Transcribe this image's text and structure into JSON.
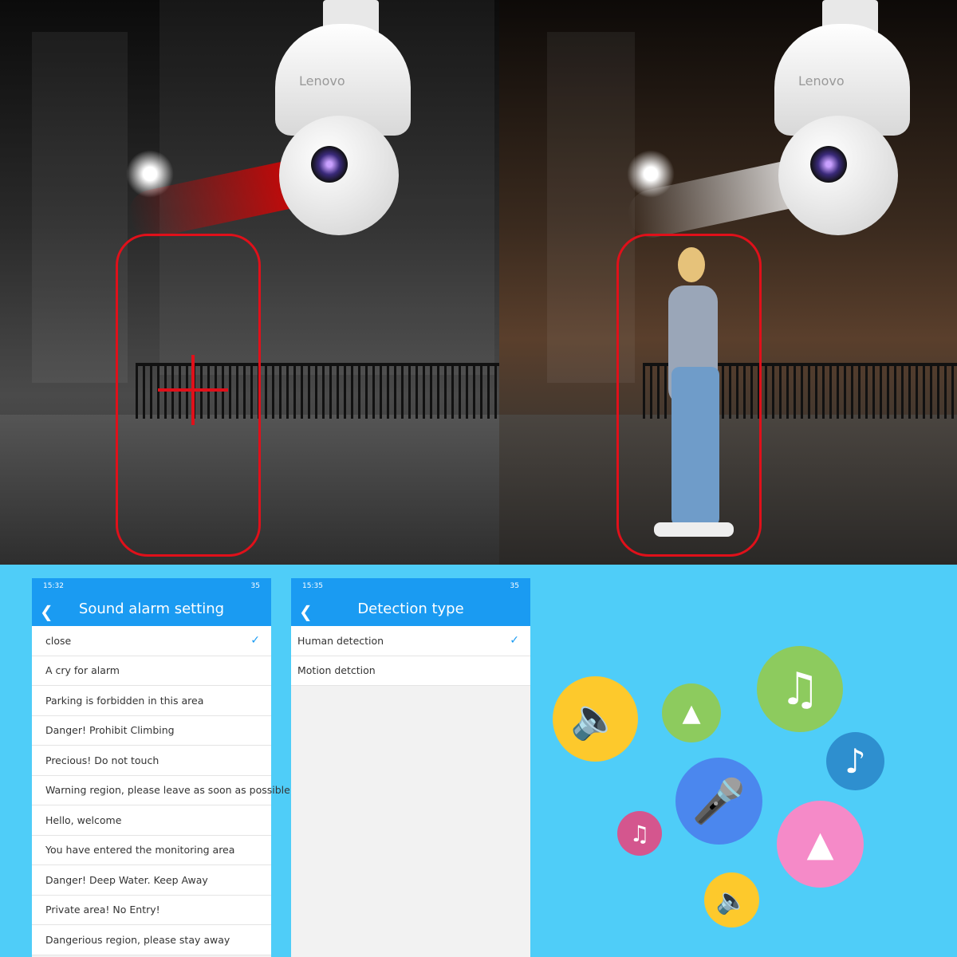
{
  "photos": {
    "camera_brand": "Lenovo"
  },
  "sound_alarm": {
    "status_time": "15:32",
    "battery": "35",
    "title": "Sound alarm setting",
    "items": [
      {
        "label": "close",
        "selected": true
      },
      {
        "label": "A cry for alarm"
      },
      {
        "label": "Parking is forbidden in this area"
      },
      {
        "label": "Danger! Prohibit Climbing"
      },
      {
        "label": "Precious! Do not touch"
      },
      {
        "label": "Warning region, please leave as soon as possible"
      },
      {
        "label": "Hello, welcome"
      },
      {
        "label": "You have entered the monitoring area"
      },
      {
        "label": "Danger! Deep Water. Keep Away"
      },
      {
        "label": "Private area! No Entry!"
      },
      {
        "label": "Dangerious region, please stay away"
      }
    ]
  },
  "detection": {
    "status_time": "15:35",
    "battery": "35",
    "title": "Detection type",
    "items": [
      {
        "label": "Human detection",
        "selected": true
      },
      {
        "label": "Motion detction"
      }
    ]
  },
  "icons": [
    "speaker-icon",
    "siren-icon",
    "music-notes-icon",
    "music-note-icon",
    "microphone-icon",
    "music-notes-icon",
    "siren-icon",
    "speaker-icon"
  ],
  "colors": {
    "header": "#1a9bf2",
    "background": "#4fcdf8",
    "alert_zone": "#e0101a"
  }
}
